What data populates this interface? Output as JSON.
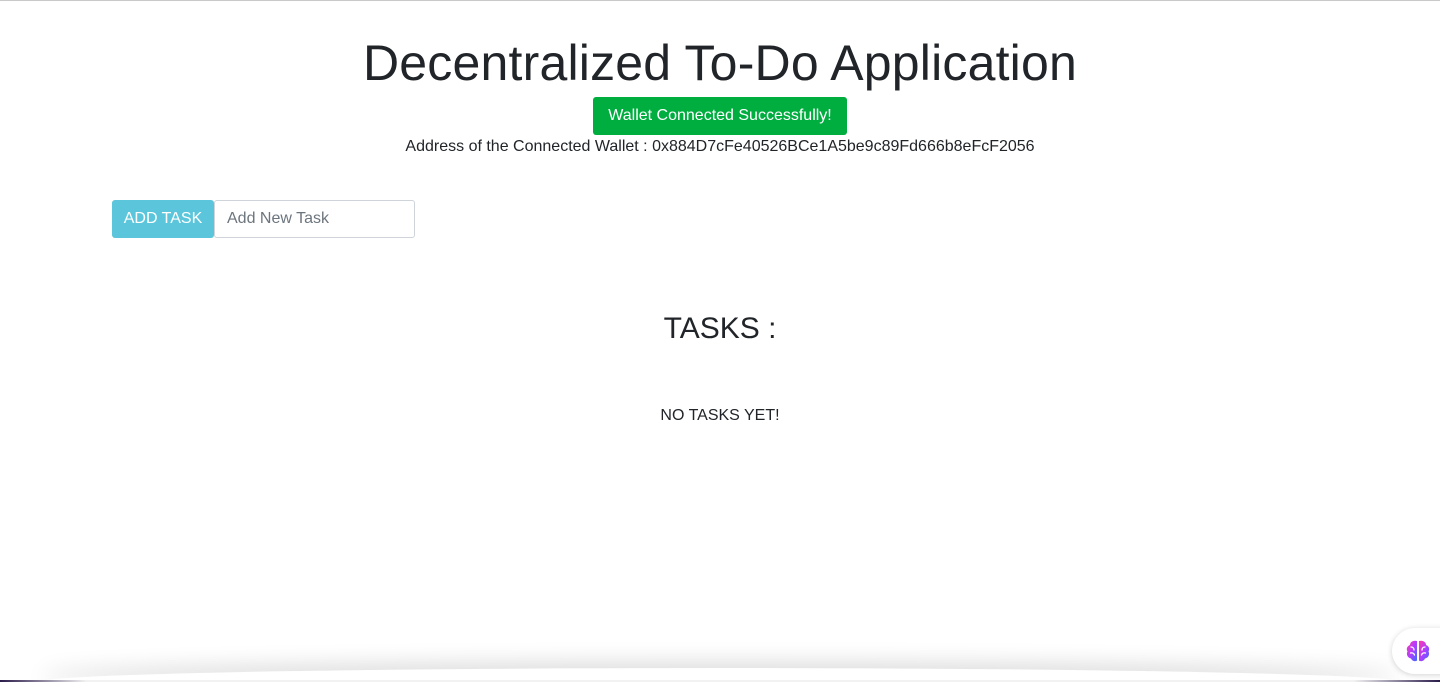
{
  "header": {
    "title": "Decentralized To-Do Application",
    "status_badge": "Wallet Connected Successfully!",
    "wallet_label": "Address of the Connected Wallet : ",
    "wallet_address": "0x884D7cFe40526BCe1A5be9c89Fd666b8eFcF2056"
  },
  "task_form": {
    "add_button_label": "ADD TASK",
    "input_placeholder": "Add New Task",
    "input_value": ""
  },
  "tasks": {
    "heading": "TASKS :",
    "empty_message": "NO TASKS YET!",
    "items": []
  },
  "widget": {
    "icon": "brain-icon"
  },
  "colors": {
    "status_green": "#00ad3f",
    "button_cyan": "#5bc6db",
    "text_dark": "#212529"
  }
}
